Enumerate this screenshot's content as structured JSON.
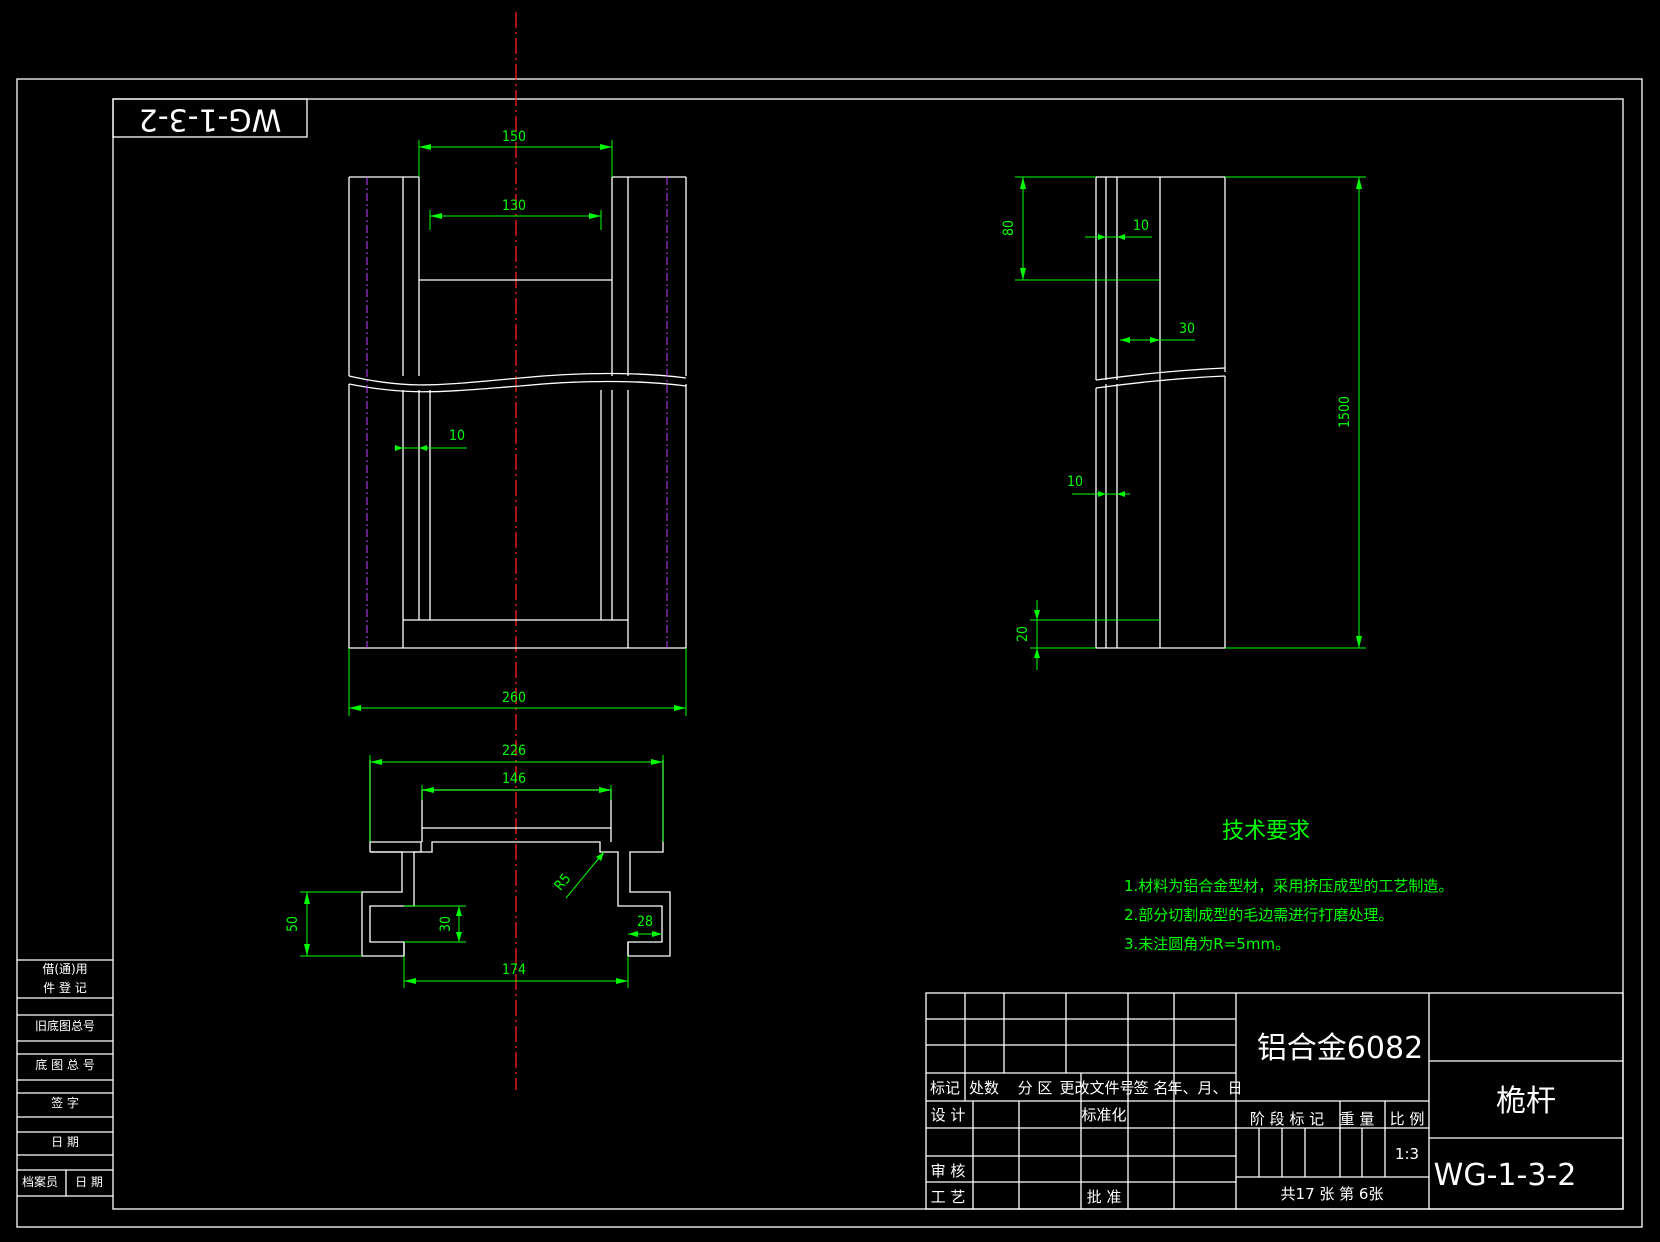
{
  "drawing": {
    "code_rotated": "WG-1-3-2",
    "front_view_dims": {
      "top_outer": "150",
      "top_inner": "130",
      "wall": "10",
      "bottom_width": "260"
    },
    "section_dims": {
      "overall": "226",
      "top": "146",
      "radius": "R5",
      "height": "50",
      "slot": "30",
      "lip": "28",
      "bottom": "174"
    },
    "side_view_dims": {
      "head": "80",
      "wall_a": "10",
      "wall_b": "30",
      "length": "1500",
      "wall_c": "10",
      "foot": "20"
    }
  },
  "tech_requirements": {
    "title": "技术要求",
    "items": [
      "1.材料为铝合金型材，采用挤压成型的工艺制造。",
      "2.部分切割成型的毛边需进行打磨处理。",
      "3.未注圆角为R=5mm。"
    ]
  },
  "left_strip": {
    "labels": [
      "借(通)用",
      "件 登 记",
      "旧底图总号",
      "底 图 总 号",
      "签  字",
      "日  期",
      "档案员",
      "日 期"
    ]
  },
  "title_block": {
    "headers": [
      "标记",
      "处数",
      "分 区",
      "更改文件号",
      "签 名",
      "年、月、日"
    ],
    "design": "设 计",
    "standardize": "标准化",
    "review": "审 核",
    "process": "工 艺",
    "approve": "批 准",
    "material": "铝合金6082",
    "stage_mark": "阶 段 标 记",
    "weight": "重 量",
    "ratio": "比 例",
    "scale_value": "1:3",
    "sheets": "共17  张    第  6张",
    "part_name": "桅杆",
    "drawing_no": "WG-1-3-2"
  }
}
